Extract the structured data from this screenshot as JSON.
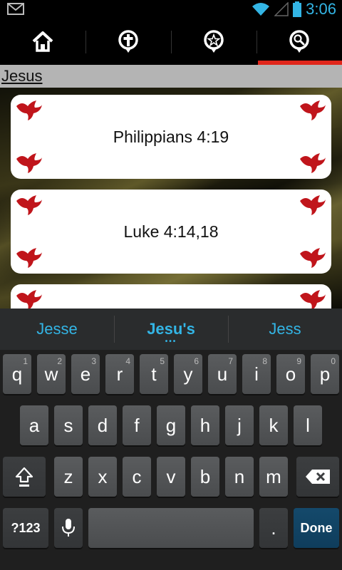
{
  "status_bar": {
    "time": "3:06",
    "icons": [
      "gmail-icon",
      "wifi-icon",
      "signal-icon",
      "battery-icon"
    ]
  },
  "tabs": [
    {
      "name": "home",
      "icon": "home-icon",
      "active": false
    },
    {
      "name": "cross",
      "icon": "cross-icon",
      "active": false
    },
    {
      "name": "favorites",
      "icon": "star-icon",
      "active": false
    },
    {
      "name": "search",
      "icon": "search-icon",
      "active": true
    }
  ],
  "search": {
    "value": "Jesus"
  },
  "results": [
    {
      "reference": "Philippians 4:19"
    },
    {
      "reference": "Luke 4:14,18"
    },
    {
      "reference": ""
    }
  ],
  "keyboard": {
    "suggestions": [
      "Jesse",
      "Jesu's",
      "Jess"
    ],
    "row1": [
      {
        "label": "q",
        "hint": "1"
      },
      {
        "label": "w",
        "hint": "2"
      },
      {
        "label": "e",
        "hint": "3"
      },
      {
        "label": "r",
        "hint": "4"
      },
      {
        "label": "t",
        "hint": "5"
      },
      {
        "label": "y",
        "hint": "6"
      },
      {
        "label": "u",
        "hint": "7"
      },
      {
        "label": "i",
        "hint": "8"
      },
      {
        "label": "o",
        "hint": "9"
      },
      {
        "label": "p",
        "hint": "0"
      }
    ],
    "row2": [
      "a",
      "s",
      "d",
      "f",
      "g",
      "h",
      "j",
      "k",
      "l"
    ],
    "row3": [
      "z",
      "x",
      "c",
      "v",
      "b",
      "n",
      "m"
    ],
    "symbols_label": "?123",
    "period_label": ".",
    "done_label": "Done"
  },
  "colors": {
    "accent": "#33b5e5",
    "active_tab": "#e0261b",
    "dove": "#c0151b"
  }
}
